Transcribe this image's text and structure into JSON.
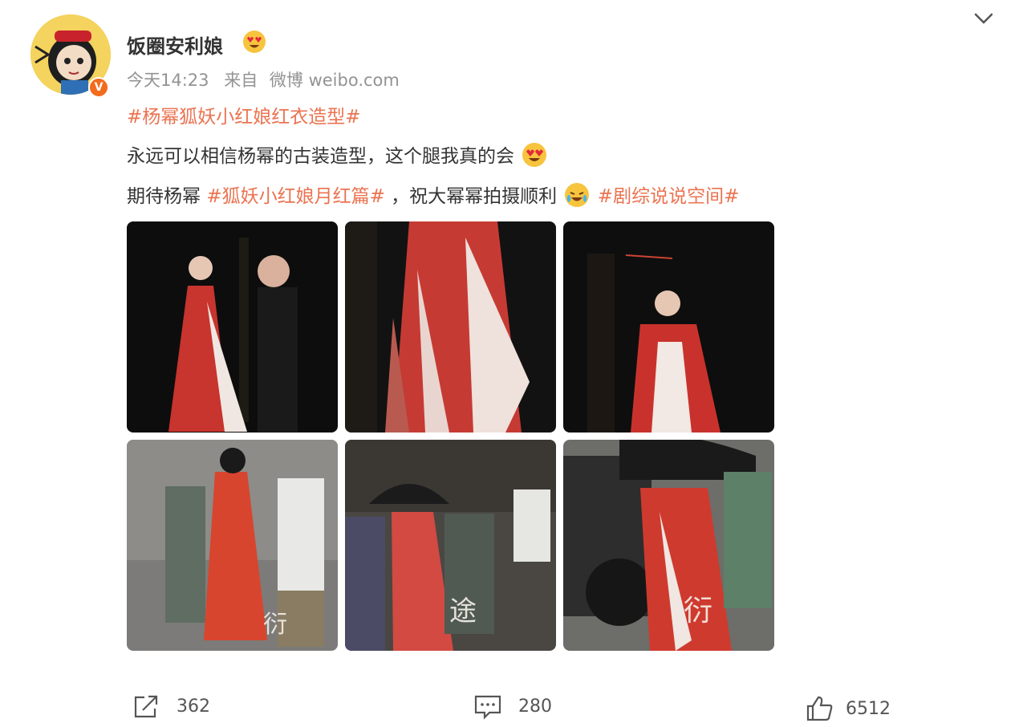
{
  "user": {
    "name": "饭圈安利娘",
    "verified_badge": "V",
    "badge_color": "#f36b1c"
  },
  "meta": {
    "time": "今天14:23",
    "source_prefix": "来自",
    "source": "微博 weibo.com"
  },
  "post": {
    "line1": {
      "tag": "#杨幂狐妖小红娘红衣造型#"
    },
    "line2": {
      "text": "永远可以相信杨幂的古装造型，这个腿我真的会",
      "emoji": "heart-eyes-icon"
    },
    "line3": {
      "prefix": "期待杨幂 ",
      "tag1": "#狐妖小红娘月红篇#",
      "middle": " ，祝大幂幂拍摄顺利",
      "emoji": "crying-laughing-icon",
      "tag2": " #剧综说说空间#"
    }
  },
  "actions": {
    "repost_count": "362",
    "comment_count": "280",
    "like_count": "6512"
  },
  "colors": {
    "tag": "#eb7350",
    "text": "#333333",
    "meta": "#939393",
    "accent": "#f36b1c"
  }
}
